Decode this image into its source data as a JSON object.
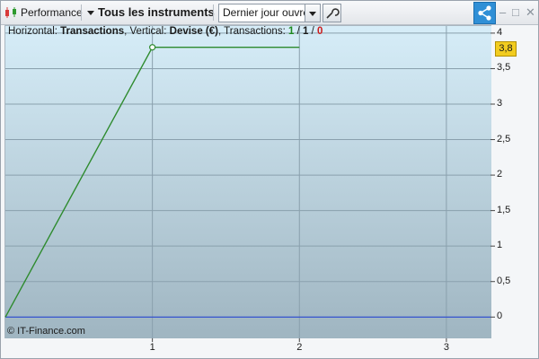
{
  "toolbar": {
    "performance_label": "Performance",
    "instrument_label": "Tous les instruments",
    "period_select": "Dernier jour ouvré",
    "window_controls": [
      "–",
      "□",
      "✕"
    ]
  },
  "chart_info": {
    "prefix": "Horizontal:",
    "horizontal": "Transactions",
    "mid": ", Vertical:",
    "vertical": "Devise (€)",
    "trans_label": ", Transactions:",
    "trans_green": "1",
    "slash1": " / ",
    "trans_black": "1",
    "slash2": " / ",
    "trans_red": "0"
  },
  "copyright": "© IT-Finance.com",
  "current_value_tag": "3,8",
  "chart_data": {
    "type": "line",
    "x": [
      0,
      1,
      2
    ],
    "series": [
      {
        "values": [
          0,
          3.8,
          3.8
        ],
        "color": "#2e8b2e"
      }
    ],
    "baseline": {
      "y": 0,
      "color": "#1f3fd6"
    },
    "xlim": [
      0,
      3.3
    ],
    "ylim": [
      -0.3,
      4.1
    ],
    "x_ticks": [
      "1",
      "2",
      "3"
    ],
    "y_ticks": [
      "4",
      "3,5",
      "3",
      "2,5",
      "2",
      "1,5",
      "1",
      "0,5",
      "0"
    ],
    "grid": true
  }
}
